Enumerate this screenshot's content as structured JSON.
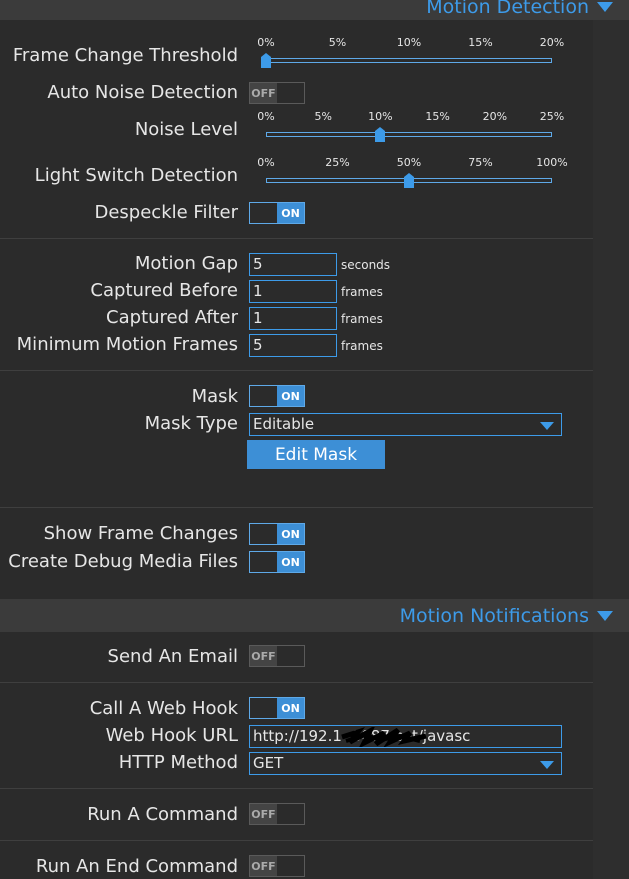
{
  "motion_detection": {
    "header": "Motion Detection",
    "frame_change_threshold": {
      "label": "Frame Change Threshold",
      "ticks": [
        "0%",
        "5%",
        "10%",
        "15%",
        "20%"
      ],
      "value_percent": 0,
      "max_percent": 20
    },
    "auto_noise_detection": {
      "label": "Auto Noise Detection",
      "state": "OFF"
    },
    "noise_level": {
      "label": "Noise Level",
      "ticks": [
        "0%",
        "5%",
        "10%",
        "15%",
        "20%",
        "25%"
      ],
      "value_percent": 10,
      "max_percent": 25
    },
    "light_switch_detection": {
      "label": "Light Switch Detection",
      "ticks": [
        "0%",
        "25%",
        "50%",
        "75%",
        "100%"
      ],
      "value_percent": 50,
      "max_percent": 100
    },
    "despeckle_filter": {
      "label": "Despeckle Filter",
      "state": "ON"
    },
    "motion_gap": {
      "label": "Motion Gap",
      "value": "5",
      "unit": "seconds"
    },
    "captured_before": {
      "label": "Captured Before",
      "value": "1",
      "unit": "frames"
    },
    "captured_after": {
      "label": "Captured After",
      "value": "1",
      "unit": "frames"
    },
    "minimum_motion_frames": {
      "label": "Minimum Motion Frames",
      "value": "5",
      "unit": "frames"
    },
    "mask": {
      "label": "Mask",
      "state": "ON"
    },
    "mask_type": {
      "label": "Mask Type",
      "value": "Editable"
    },
    "edit_mask_button": "Edit Mask",
    "show_frame_changes": {
      "label": "Show Frame Changes",
      "state": "ON"
    },
    "create_debug_media_files": {
      "label": "Create Debug Media Files",
      "state": "ON"
    }
  },
  "motion_notifications": {
    "header": "Motion Notifications",
    "send_an_email": {
      "label": "Send An Email",
      "state": "OFF"
    },
    "call_a_web_hook": {
      "label": "Call A Web Hook",
      "state": "ON"
    },
    "web_hook_url": {
      "label": "Web Hook URL",
      "value": "http://192.1 :8087/set/javasc"
    },
    "http_method": {
      "label": "HTTP Method",
      "value": "GET"
    },
    "run_a_command": {
      "label": "Run A Command",
      "state": "OFF"
    },
    "run_an_end_command": {
      "label": "Run An End Command",
      "state": "OFF"
    }
  },
  "colors": {
    "accent": "#3d9be9",
    "background": "#2b2b2b",
    "section_bar": "#3b3b3b"
  }
}
